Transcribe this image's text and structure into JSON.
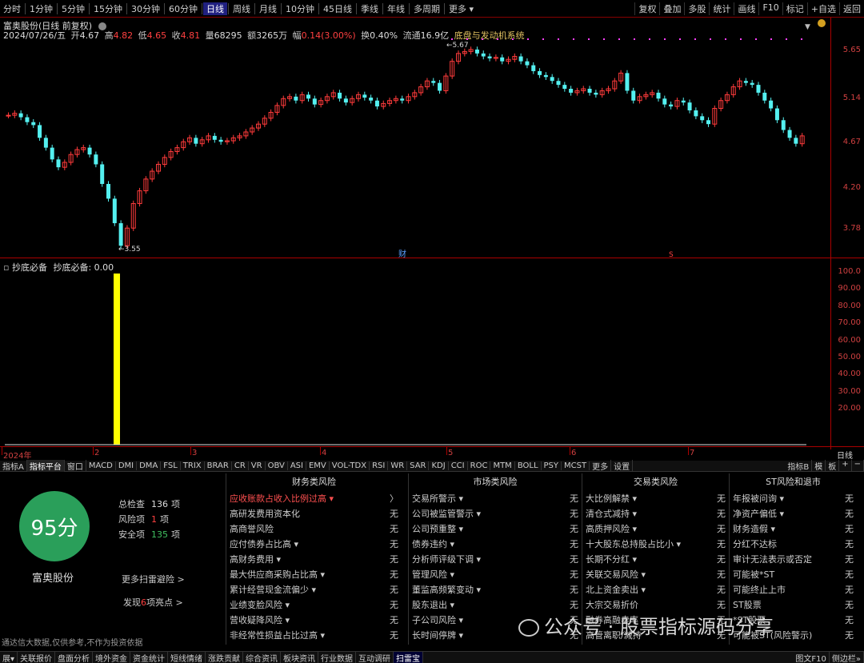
{
  "toolbar": {
    "periods": [
      "分时",
      "1分钟",
      "5分钟",
      "15分钟",
      "30分钟",
      "60分钟",
      "日线",
      "周线",
      "月线",
      "10分钟",
      "45日线",
      "季线",
      "年线",
      "多周期",
      "更多 ▾"
    ],
    "active_period": "日线",
    "right_items": [
      "复权",
      "叠加",
      "多股",
      "统计",
      "画线",
      "F10",
      "标记",
      "+自选",
      "返回"
    ]
  },
  "chart_header": {
    "stock_title": "富奥股份(日线 前复权)",
    "date": "2024/07/26/五",
    "open_label": "开",
    "open": "4.67",
    "high_label": "高",
    "high": "4.82",
    "low_label": "低",
    "low": "4.65",
    "close_label": "收",
    "close": "4.81",
    "volume_label": "量",
    "volume": "68295",
    "amount_label": "额",
    "amount": "3265万",
    "change_label": "幅",
    "change": "0.14(3.00%)",
    "turnover_label": "换",
    "turnover": "0.40%",
    "float_label": "流通",
    "float_value": "16.9亿",
    "concept": "底盘与发动机系统"
  },
  "price_axis": [
    "5.65",
    "5.14",
    "4.67",
    "4.20",
    "3.78"
  ],
  "markers": {
    "high": "5.67",
    "low": "3.55",
    "cai": "财",
    "bottom_mark": "S"
  },
  "indicator": {
    "title": "抄底必备",
    "value_line": "抄底必备: 0.00",
    "axis": [
      "100.0",
      "90.00",
      "80.00",
      "70.00",
      "60.00",
      "50.00",
      "40.00",
      "30.00",
      "20.00"
    ]
  },
  "time_axis": {
    "labels": [
      "2024年",
      "2",
      "3",
      "4",
      "5",
      "6",
      "7"
    ],
    "right": "日线"
  },
  "indicator_tabs": [
    "指标A",
    "指标平台",
    "窗口",
    "MACD",
    "DMI",
    "DMA",
    "FSL",
    "TRIX",
    "BRAR",
    "CR",
    "VR",
    "OBV",
    "ASI",
    "EMV",
    "VOL-TDX",
    "RSI",
    "WR",
    "SAR",
    "KDJ",
    "CCI",
    "ROC",
    "MTM",
    "BOLL",
    "PSY",
    "MCST",
    "更多",
    "设置"
  ],
  "indicator_tabs_right": [
    "指标B",
    "模",
    "板",
    "+",
    "−"
  ],
  "risk": {
    "score": "95分",
    "stock_name": "富奥股份",
    "summary": [
      {
        "label": "总检查",
        "value": "136",
        "unit": "项"
      },
      {
        "label": "风险项",
        "value": "1",
        "unit": "项"
      },
      {
        "label": "安全项",
        "value": "135",
        "unit": "项"
      }
    ],
    "more_link": "更多扫雷避险 >",
    "find_prefix": "发现",
    "find_count": "6",
    "find_suffix": "项亮点 >",
    "disclaimer": "通达信大数据,仅供参考,不作为投资依据",
    "columns": [
      {
        "title": "财务类风险",
        "rows": [
          {
            "name": "应收账款占收入比例过高 ▾",
            "value": "〉",
            "hi": true
          },
          {
            "name": "高研发费用资本化",
            "value": "无"
          },
          {
            "name": "高商誉风险",
            "value": "无"
          },
          {
            "name": "应付债券占比高 ▾",
            "value": "无"
          },
          {
            "name": "高财务费用 ▾",
            "value": "无"
          },
          {
            "name": "最大供应商采购占比高 ▾",
            "value": "无"
          },
          {
            "name": "累计经营现金流偏少 ▾",
            "value": "无"
          },
          {
            "name": "业绩变脸风险 ▾",
            "value": "无"
          },
          {
            "name": "营收疑降风险 ▾",
            "value": "无"
          },
          {
            "name": "非经常性损益占比过高 ▾",
            "value": "无"
          }
        ]
      },
      {
        "title": "市场类风险",
        "rows": [
          {
            "name": "交易所警示 ▾",
            "value": "无"
          },
          {
            "name": "公司被监管警示 ▾",
            "value": "无"
          },
          {
            "name": "公司预重整 ▾",
            "value": "无"
          },
          {
            "name": "债券违约 ▾",
            "value": "无"
          },
          {
            "name": "分析师评级下调 ▾",
            "value": "无"
          },
          {
            "name": "管理风险 ▾",
            "value": "无"
          },
          {
            "name": "董监高频繁变动 ▾",
            "value": "无"
          },
          {
            "name": "股东退出 ▾",
            "value": "无"
          },
          {
            "name": "子公司风险 ▾",
            "value": "无"
          },
          {
            "name": "长时间停牌 ▾",
            "value": "无"
          }
        ]
      },
      {
        "title": "交易类风险",
        "rows": [
          {
            "name": "大比例解禁 ▾",
            "value": "无"
          },
          {
            "name": "清仓式减持 ▾",
            "value": "无"
          },
          {
            "name": "高质押风险 ▾",
            "value": "无"
          },
          {
            "name": "十大股东总持股占比小 ▾",
            "value": "无"
          },
          {
            "name": "长期不分红 ▾",
            "value": "无"
          },
          {
            "name": "关联交易风险 ▾",
            "value": "无"
          },
          {
            "name": "北上资金卖出 ▾",
            "value": "无"
          },
          {
            "name": "大宗交易折价",
            "value": "无"
          },
          {
            "name": "融券高融卖率",
            "value": "无"
          },
          {
            "name": "高管离职/减持",
            "value": "无"
          }
        ]
      },
      {
        "title": "ST风险和退市",
        "rows": [
          {
            "name": "年报被问询 ▾",
            "value": "无"
          },
          {
            "name": "净资产偏低 ▾",
            "value": "无"
          },
          {
            "name": "财务造假 ▾",
            "value": "无"
          },
          {
            "name": "分红不达标",
            "value": "无"
          },
          {
            "name": "审计无法表示或否定",
            "value": "无"
          },
          {
            "name": "可能被*ST",
            "value": "无"
          },
          {
            "name": "可能终止上市",
            "value": "无"
          },
          {
            "name": "ST股票",
            "value": "无"
          },
          {
            "name": "*ST股票",
            "value": "无"
          },
          {
            "name": "可能被ST(风险警示)",
            "value": "无"
          }
        ]
      }
    ]
  },
  "watermark": "公众号 · 股票指标源码分享",
  "bottom_tabs": [
    "展▾",
    "关联报价",
    "盘面分析",
    "境外资金",
    "资金统计",
    "短线情绪",
    "涨跌贡献",
    "综合资讯",
    "板块资讯",
    "行业数据",
    "互动调研",
    "扫雷宝"
  ],
  "bottom_active": "扫雷宝",
  "bottom_right": [
    "图文F10",
    "侧边栏»"
  ],
  "colors": {
    "up": "#ff3b3b",
    "down": "#54f0f0",
    "axis": "#a00000",
    "indicator_bar": "#ffff00",
    "score_bg": "#2a9f5a"
  }
}
